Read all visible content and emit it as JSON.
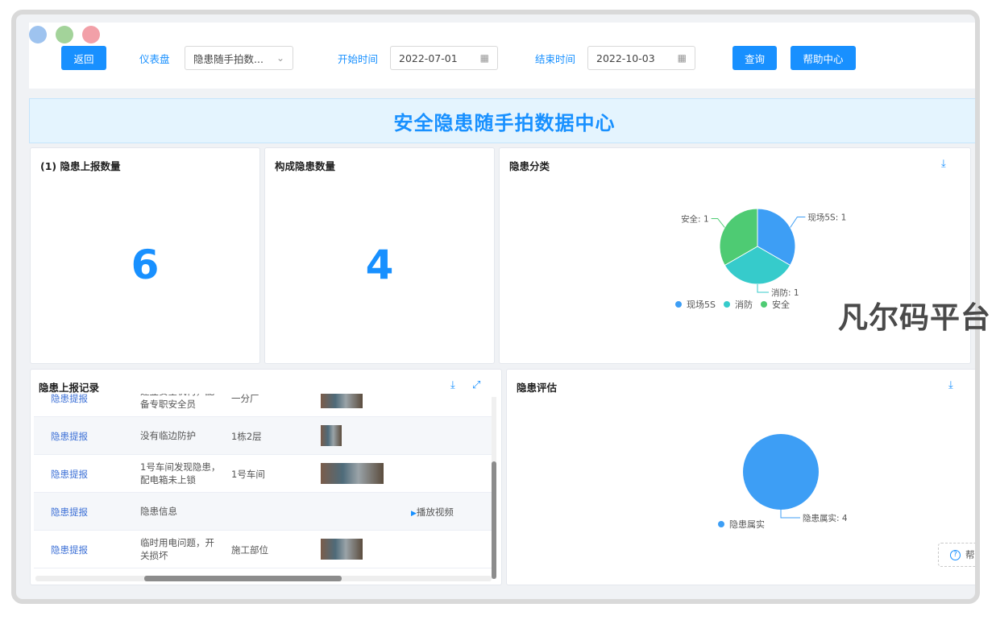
{
  "window": {
    "dot_colors": [
      "#9ec3ef",
      "#a3d39a",
      "#f2a0a8"
    ]
  },
  "toolbar": {
    "back_label": "返回",
    "dashboard_label": "仪表盘",
    "dashboard_value": "隐患随手拍数...",
    "start_label": "开始时间",
    "start_value": "2022-07-01",
    "end_label": "结束时间",
    "end_value": "2022-10-03",
    "query_label": "查询",
    "help_label": "帮助中心"
  },
  "banner": {
    "title": "安全隐患随手拍数据中心"
  },
  "kpis": [
    {
      "title": "(1) 隐患上报数量",
      "value": "6"
    },
    {
      "title": "构成隐患数量",
      "value": "4"
    }
  ],
  "category_chart": {
    "title": "隐患分类",
    "chart_data": {
      "type": "pie",
      "slices": [
        {
          "name": "现场5S",
          "value": 1,
          "label": "现场5S: 1",
          "color": "#3d9ef5"
        },
        {
          "name": "消防",
          "value": 1,
          "label": "消防: 1",
          "color": "#36cbcb"
        },
        {
          "name": "安全",
          "value": 1,
          "label": "安全: 1",
          "color": "#4ecb73"
        }
      ],
      "legend_placement": "bottom"
    }
  },
  "records": {
    "title": "隐患上报记录",
    "rows": [
      {
        "type": "隐患提报",
        "desc": "建立安全机构，配备专职安全员",
        "location": "一分厂",
        "media": "image"
      },
      {
        "type": "隐患提报",
        "desc": "没有临边防护",
        "location": "1栋2层",
        "media": "image"
      },
      {
        "type": "隐患提报",
        "desc": "1号车间发现隐患，配电箱未上锁",
        "location": "1号车间",
        "media": "image"
      },
      {
        "type": "隐患提报",
        "desc": "隐患信息",
        "location": "",
        "media": "video",
        "video_label": "播放视频"
      },
      {
        "type": "隐患提报",
        "desc": "临时用电问题，开关损坏",
        "location": "施工部位",
        "media": "image"
      }
    ]
  },
  "assessment_chart": {
    "title": "隐患评估",
    "chart_data": {
      "type": "pie",
      "slices": [
        {
          "name": "隐患属实",
          "value": 4,
          "label": "隐患属实: 4",
          "color": "#3d9ef5"
        }
      ],
      "legend_placement": "bottom"
    }
  },
  "float_help": {
    "label": "帮助"
  },
  "watermark": {
    "text": "凡尔码平台"
  }
}
